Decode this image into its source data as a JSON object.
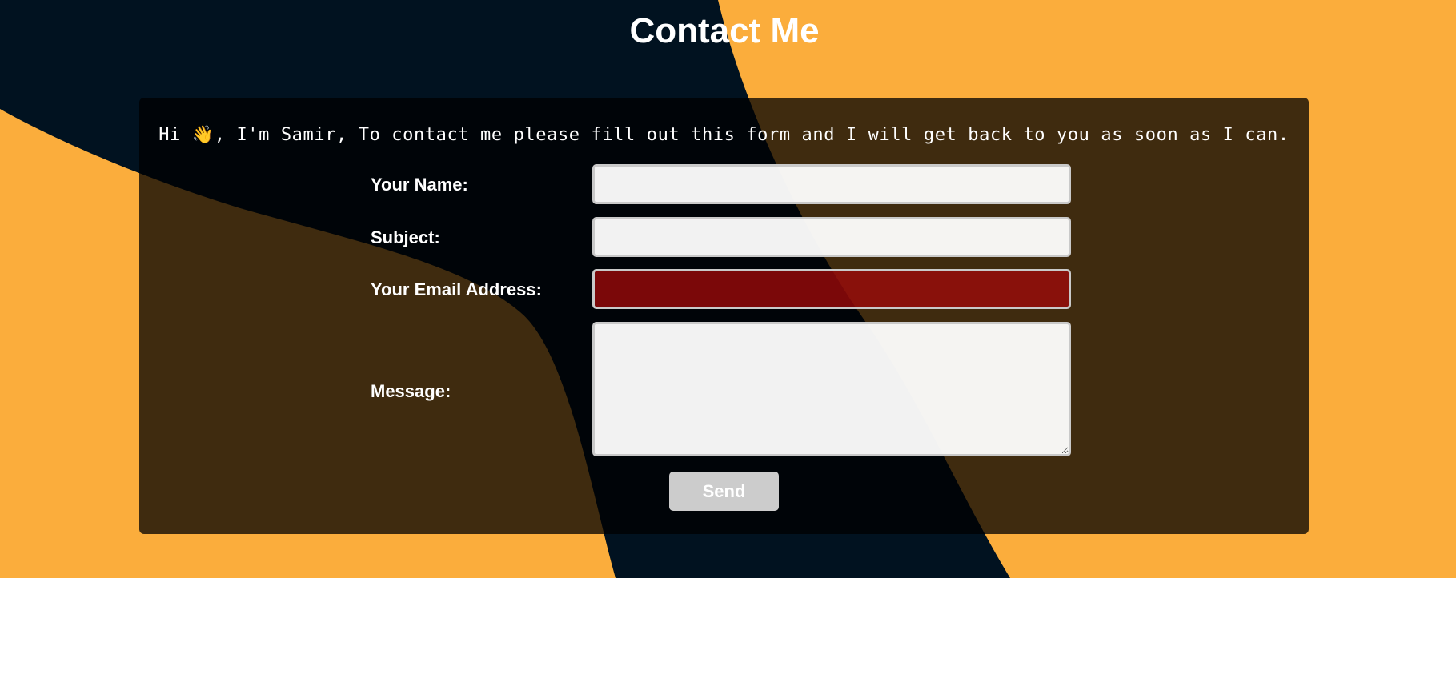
{
  "page": {
    "title": "Contact Me"
  },
  "colors": {
    "background_orange": "#fbad3c",
    "background_navy": "#011220",
    "invalid_field": "#9e0a0a",
    "button_bg": "#cccccc"
  },
  "intro": {
    "text": "Hi 👋, I'm Samir, To contact me please fill out this form and I will get back to you as soon as I can."
  },
  "form": {
    "name_label": "Your Name:",
    "name_value": "",
    "subject_label": "Subject:",
    "subject_value": "",
    "email_label": "Your Email Address:",
    "email_value": "",
    "email_state": "invalid",
    "message_label": "Message:",
    "message_value": "",
    "send_label": "Send"
  }
}
